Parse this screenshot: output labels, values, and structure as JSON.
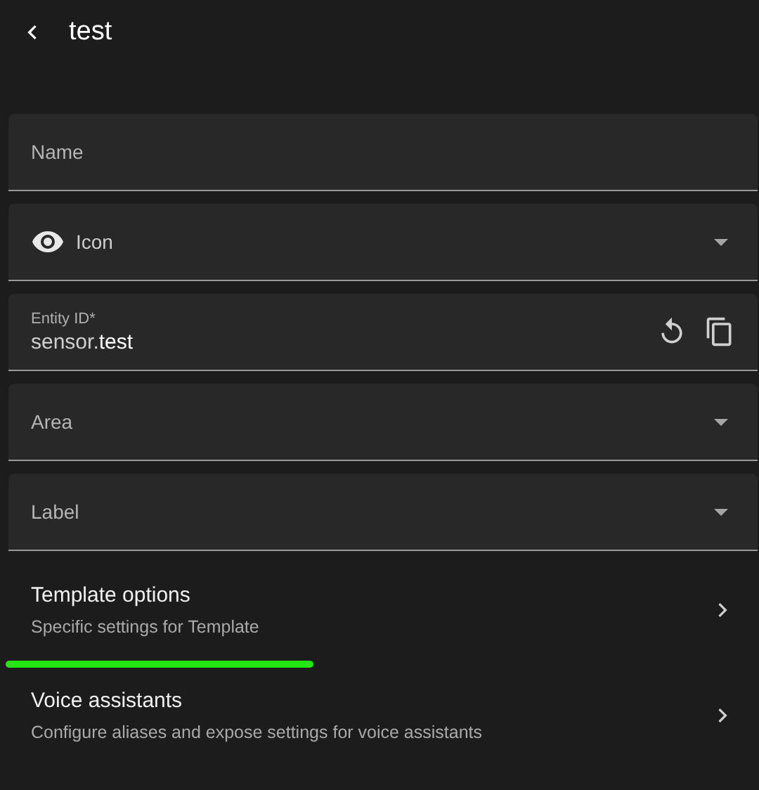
{
  "header": {
    "title": "test"
  },
  "fields": [
    {
      "kind": "text",
      "placeholder": "Name"
    },
    {
      "kind": "icon-select",
      "value": "Icon"
    },
    {
      "kind": "entity",
      "label": "Entity ID*",
      "value": "sensor.**test**"
    },
    {
      "kind": "select",
      "placeholder": "Area"
    },
    {
      "kind": "select",
      "placeholder": "Label"
    }
  ],
  "options": [
    {
      "title": "Template options",
      "subtitle": "Specific settings for Template",
      "highlighted": true
    },
    {
      "title": "Voice assistants",
      "subtitle": "Configure aliases and expose settings for voice assistants",
      "highlighted": false
    }
  ]
}
